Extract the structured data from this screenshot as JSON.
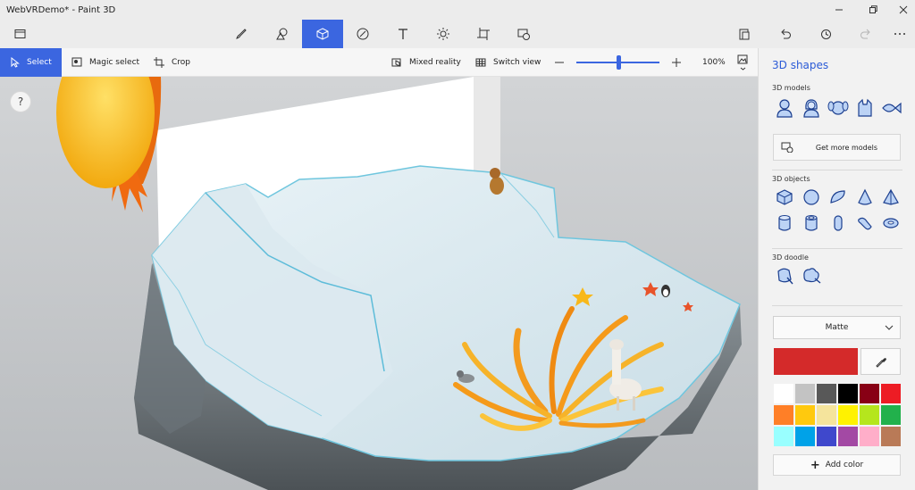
{
  "window": {
    "title": "WebVRDemo* - Paint 3D"
  },
  "ribbon": {
    "tools": [
      {
        "name": "brushes",
        "icon": "brush-icon"
      },
      {
        "name": "2d-shapes",
        "icon": "2d-shapes-icon"
      },
      {
        "name": "3d-shapes",
        "icon": "cube-icon",
        "active": true
      },
      {
        "name": "stickers",
        "icon": "sticker-icon"
      },
      {
        "name": "text",
        "icon": "text-icon"
      },
      {
        "name": "effects",
        "icon": "effects-icon"
      },
      {
        "name": "canvas",
        "icon": "canvas-icon"
      },
      {
        "name": "remix-3d",
        "icon": "remix-icon"
      }
    ]
  },
  "subbar": {
    "select": "Select",
    "magic_select": "Magic select",
    "crop": "Crop",
    "mixed_reality": "Mixed reality",
    "switch_view": "Switch view",
    "zoom": "100%",
    "zoom_level": 0.5
  },
  "help": {
    "label": "?"
  },
  "panel": {
    "title": "3D shapes",
    "models_label": "3D models",
    "get_more": "Get more models",
    "objects_label": "3D objects",
    "doodle_label": "3D doodle",
    "material": "Matte",
    "add_color": "Add color",
    "current_color": "#d42a2a",
    "palette": [
      "#ffffff",
      "#c3c3c3",
      "#585858",
      "#000000",
      "#880015",
      "#ed1c24",
      "#ff7f27",
      "#ffc90e",
      "#f5e49c",
      "#fff200",
      "#b5e61d",
      "#22b14c",
      "#99ffff",
      "#00a2e8",
      "#3f48cc",
      "#a349a4",
      "#ffaec9",
      "#b97a57"
    ]
  },
  "colors": {
    "accent": "#3b66e0"
  }
}
